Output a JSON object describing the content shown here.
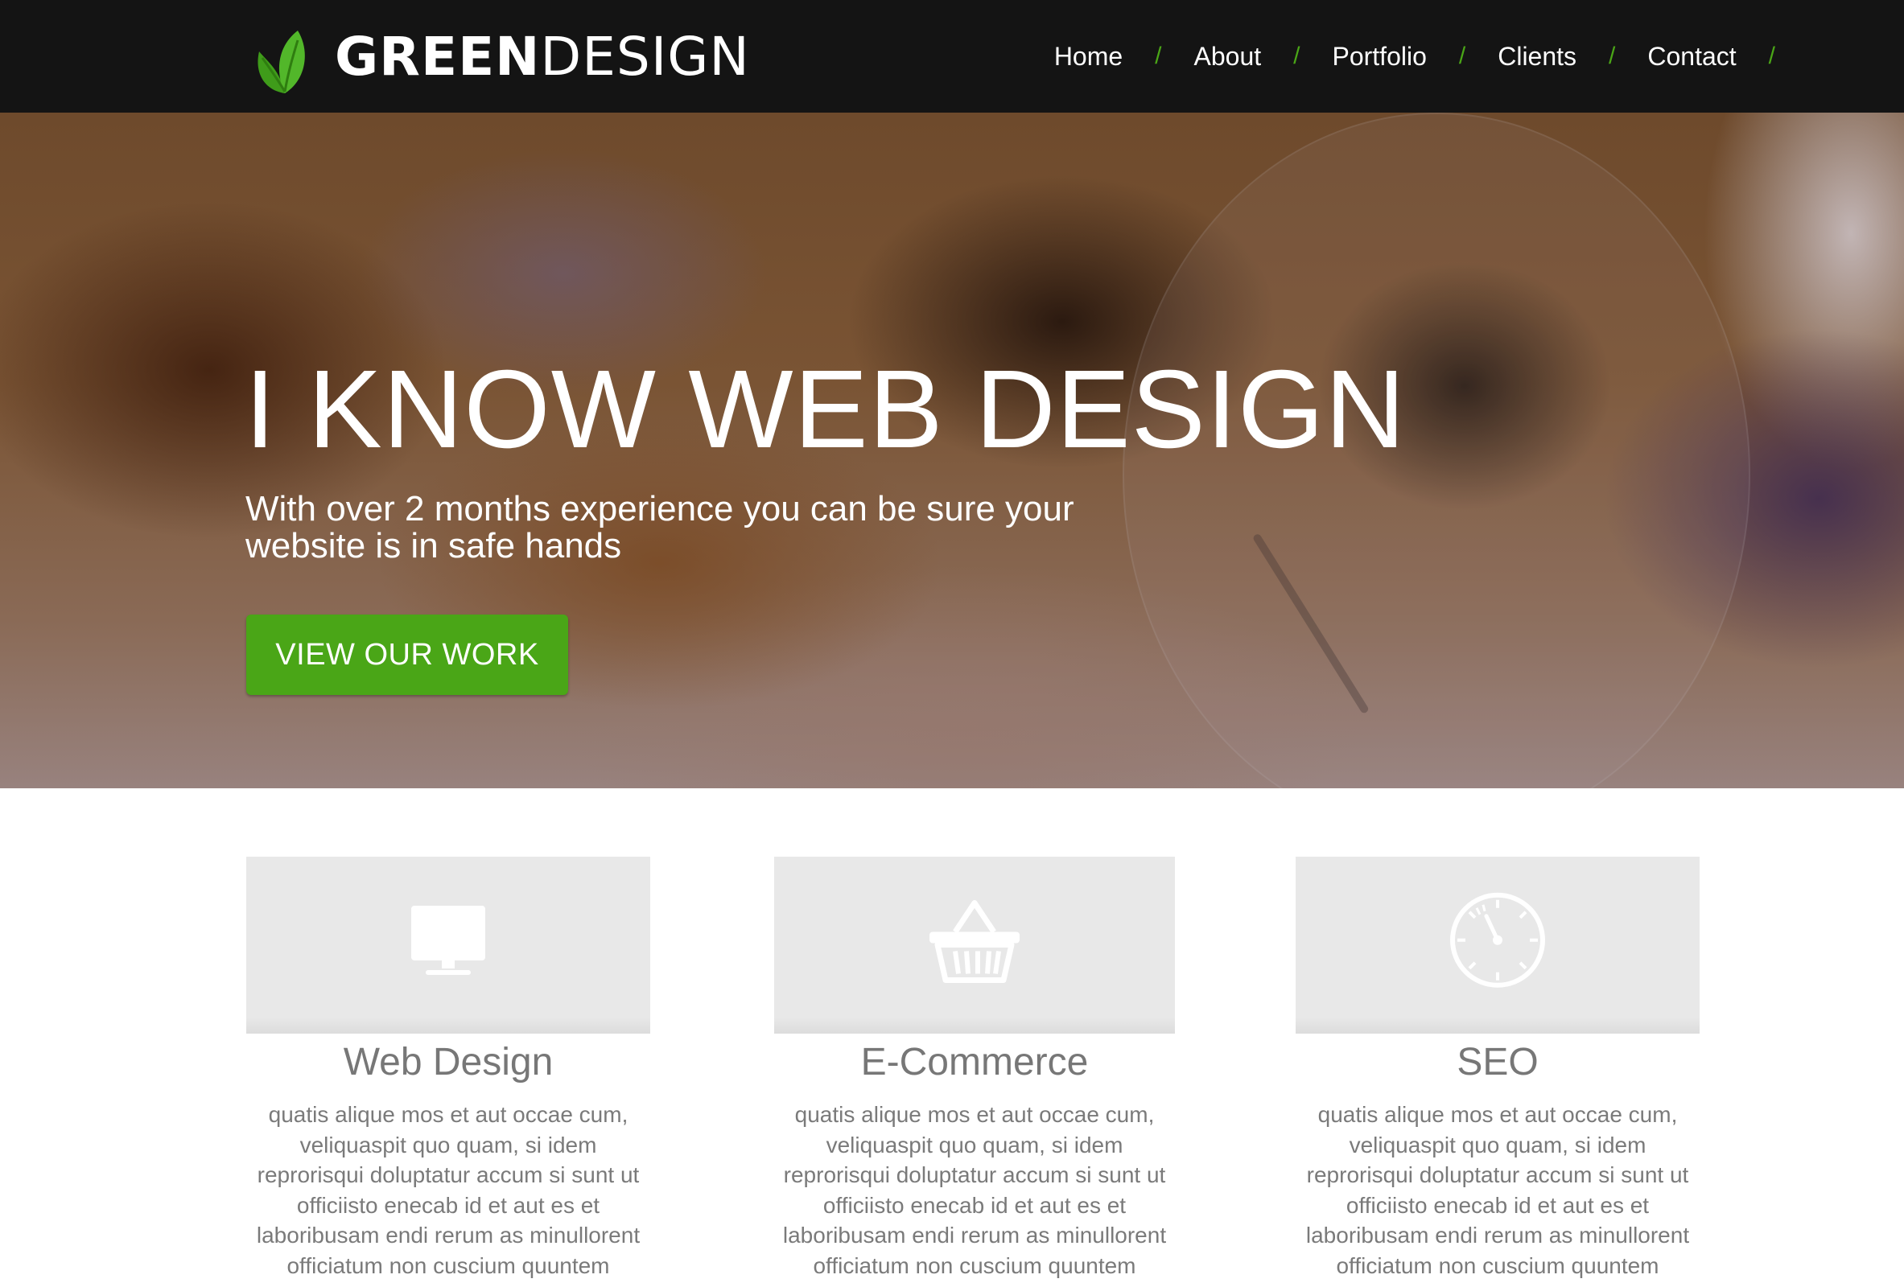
{
  "header": {
    "logo": {
      "bold": "GREEN",
      "light": "DESIGN"
    },
    "nav": [
      {
        "label": "Home"
      },
      {
        "label": "About"
      },
      {
        "label": "Portfolio"
      },
      {
        "label": "Clients"
      },
      {
        "label": "Contact"
      }
    ],
    "separator": "/"
  },
  "hero": {
    "title": "I KNOW WEB DESIGN",
    "subtitle": "With over 2 months experience you can be sure your website is in safe hands",
    "cta_label": "VIEW OUR WORK"
  },
  "services": [
    {
      "icon": "monitor-icon",
      "title": "Web Design",
      "text": "quatis alique mos et aut occae cum, veliquaspit quo quam, si idem reprorisqui doluptatur accum si sunt ut officiisto enecab id et aut es et laboribusam endi rerum as minullorent officiatum non cuscium quuntem"
    },
    {
      "icon": "basket-icon",
      "title": "E-Commerce",
      "text": "quatis alique mos et aut occae cum, veliquaspit quo quam, si idem reprorisqui doluptatur accum si sunt ut officiisto enecab id et aut es et laboribusam endi rerum as minullorent officiatum non cuscium quuntem"
    },
    {
      "icon": "speedometer-icon",
      "title": "SEO",
      "text": "quatis alique mos et aut occae cum, veliquaspit quo quam, si idem reprorisqui doluptatur accum si sunt ut officiisto enecab id et aut es et laboribusam endi rerum as minullorent officiatum non cuscium quuntem"
    }
  ],
  "colors": {
    "accent": "#4aa617",
    "header_bg": "#141414",
    "service_box_bg": "#e8e8e8",
    "text_gray": "#777777"
  }
}
